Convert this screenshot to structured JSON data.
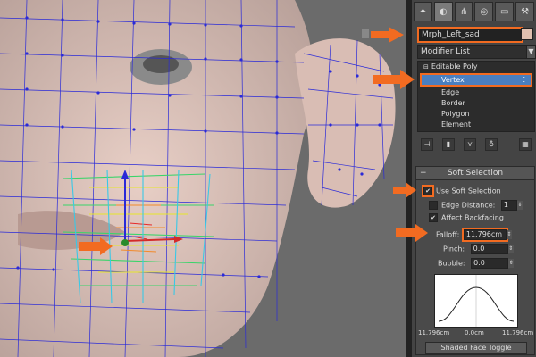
{
  "toolbar": {
    "icons": [
      "create-icon",
      "modify-icon",
      "hierarchy-icon",
      "motion-icon",
      "display-icon",
      "utilities-icon"
    ]
  },
  "object_name": "Mrph_Left_sad",
  "modifier_list": {
    "label": "Modifier List"
  },
  "stack": {
    "root": "Editable Poly",
    "items": [
      "Vertex",
      "Edge",
      "Border",
      "Polygon",
      "Element"
    ],
    "selected": "Vertex"
  },
  "soft_selection": {
    "title": "Soft Selection",
    "use_soft_selection": "Use Soft Selection",
    "edge_distance_label": "Edge Distance:",
    "edge_distance_value": "1",
    "affect_backfacing": "Affect Backfacing",
    "falloff_label": "Falloff:",
    "falloff_value": "11.796cm",
    "pinch_label": "Pinch:",
    "pinch_value": "0.0",
    "bubble_label": "Bubble:",
    "bubble_value": "0.0",
    "graph_left": "11.796cm",
    "graph_mid": "0.0cm",
    "graph_right": "11.796cm",
    "shaded_face_toggle": "Shaded Face Toggle"
  },
  "colors": {
    "highlight": "#f26b21",
    "selection": "#4a7fc1",
    "wire": "#2a2ad8"
  }
}
